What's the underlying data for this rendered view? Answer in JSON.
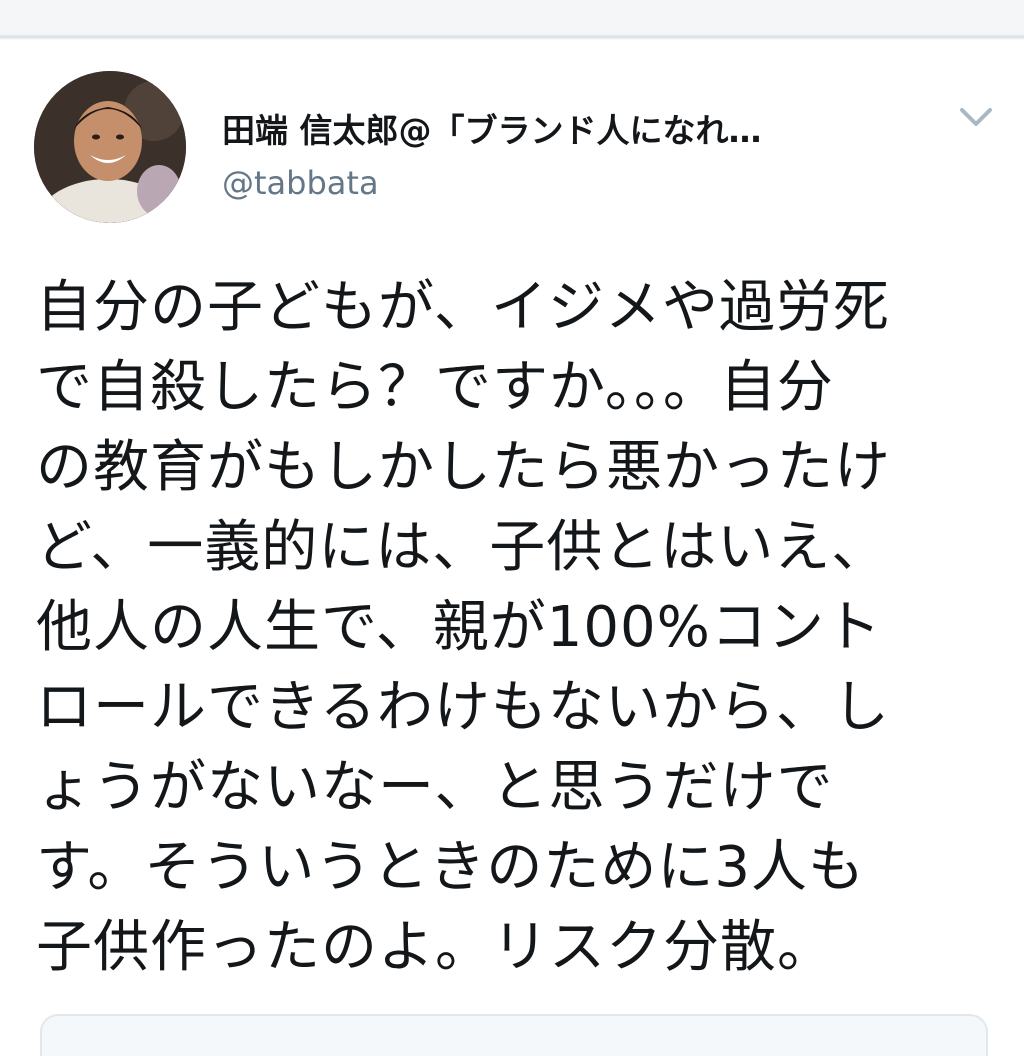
{
  "tweet": {
    "display_name": "田端 信太郎@「ブランド人になれ…",
    "handle": "@tabbata",
    "text_lines": [
      "自分の子どもが、イジメや過労死",
      "で自殺したら？ですか。。。自分",
      "の教育がもしかしたら悪かったけ",
      "ど、一義的には、子供とはいえ、",
      "他人の人生で、親が100%コント",
      "ロールできるわけもないから、し",
      "ょうがないなー、と思うだけで",
      "す。そういうときのために3人も",
      "子供作ったのよ。リスク分散。"
    ]
  },
  "icons": {
    "menu": "chevron-down-icon",
    "avatar": "profile-photo"
  },
  "colors": {
    "text": "#14171a",
    "secondary": "#657786",
    "divider": "#d9dee2",
    "chevron": "#aab8c2"
  }
}
